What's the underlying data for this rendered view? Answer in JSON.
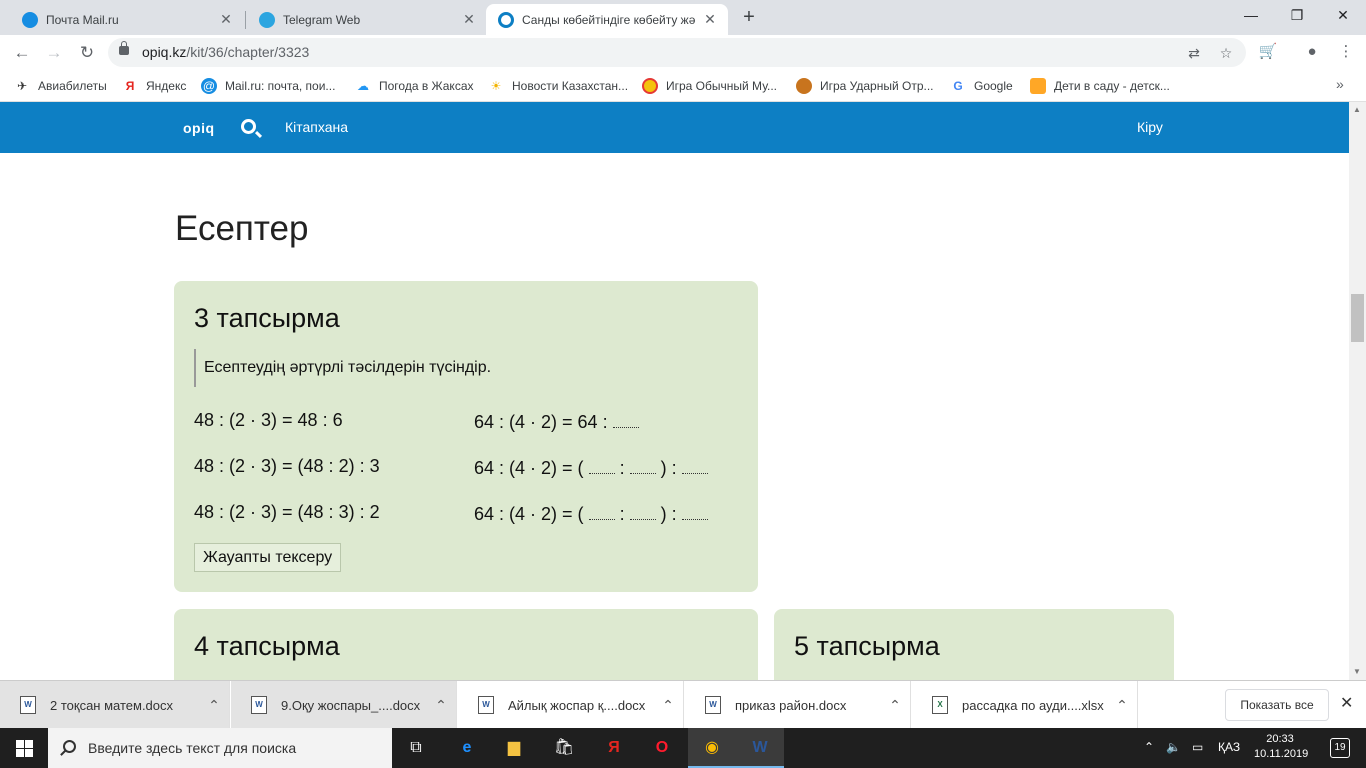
{
  "browser": {
    "tabs": [
      {
        "title": "Почта Mail.ru",
        "favicon_color": "#168de2"
      },
      {
        "title": "Telegram Web",
        "favicon_color": "#2ca5e0"
      },
      {
        "title": "Санды көбейтіндіге көбейту жә",
        "favicon_color": "#0d7fc4"
      }
    ],
    "new_tab_label": "+",
    "url_host": "opiq.kz",
    "url_path": "/kit/36/chapter/3323",
    "bookmarks": [
      "Авиабилеты",
      "Яндекс",
      "Mail.ru: почта, пои...",
      "Погода в Жаксах",
      "Новости Казахстан...",
      "Игра Обычный Му...",
      "Игра Ударный Отр...",
      "Google",
      "Дети в саду - детск..."
    ]
  },
  "site": {
    "logo": "opiq",
    "nav_library": "Кітапхана",
    "nav_login": "Кіру"
  },
  "page": {
    "title": "Есептер",
    "task3": {
      "title": "3 тапсырма",
      "instruction": "Есептеудің әртүрлі тәсілдерін түсіндір.",
      "left_rows": [
        "48 : (2 · 3) = 48 : 6",
        "48 : (2 · 3) = (48 : 2) : 3",
        "48 : (2 · 3) = (48 : 3) : 2"
      ],
      "right_row1": "64 : (4 · 2) = 64 :",
      "right_row_prefix": "64 : (4 · 2) = (",
      "sep_colon": ":",
      "close_colon": ") :",
      "check_button": "Жауапты тексеру"
    },
    "task4": {
      "title": "4 тапсырма"
    },
    "task5": {
      "title": "5 тапсырма"
    }
  },
  "downloads": {
    "items": [
      "2 тоқсан матем.docx",
      "9.Оқу жоспары_....docx",
      "Айлық жоспар қ....docx",
      "приказ район.docx",
      "рассадка по  ауди....xlsx"
    ],
    "show_all": "Показать все"
  },
  "taskbar": {
    "search_placeholder": "Введите здесь текст для поиска",
    "lang": "ҚАЗ",
    "time": "20:33",
    "date": "10.11.2019",
    "notifications": "19"
  }
}
